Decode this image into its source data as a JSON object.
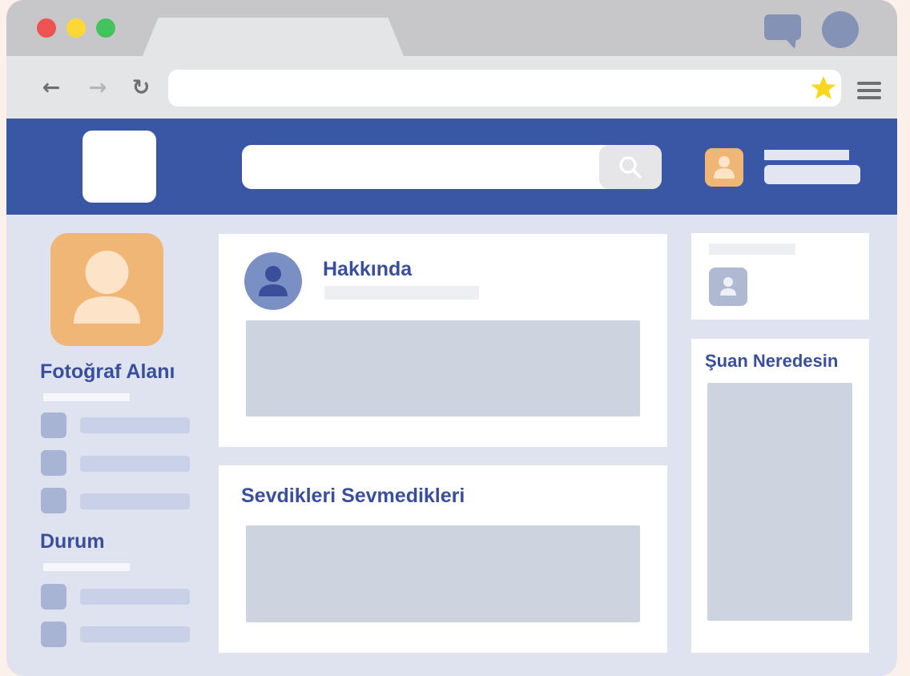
{
  "browser": {
    "traffic_lights": [
      "#ef5350",
      "#fdd835",
      "#43c35e"
    ],
    "nav": {
      "back": "←",
      "forward": "→",
      "reload": "↻"
    },
    "bookmark_icon": "star-icon",
    "menu_icon": "hamburger-icon",
    "chat_icon": "chat-icon",
    "profile_icon": "avatar-circle-icon"
  },
  "colors": {
    "header": "#3a57a5",
    "accent_text": "#3a4f9b",
    "avatar_orange": "#efb675",
    "star": "#f9d71c"
  },
  "sidebar": {
    "photo_title": "Fotoğraf Alanı",
    "status_title": "Durum"
  },
  "main": {
    "about_title": "Hakkında",
    "likes_title": "Sevdikleri Sevmedikleri"
  },
  "right": {
    "location_title": "Şuan Neredesin"
  }
}
